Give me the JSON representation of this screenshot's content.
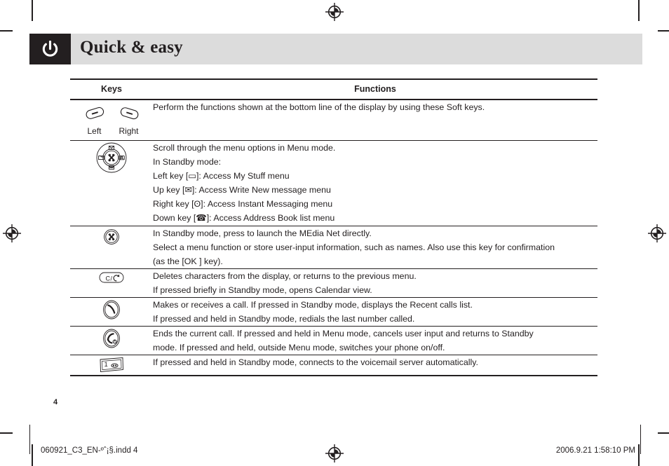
{
  "page": {
    "number": "4",
    "paper_color": "#ffffff",
    "ink_color": "#231f20",
    "header_band_color": "#dcdcdc",
    "header_icon_block_color": "#231f20"
  },
  "header": {
    "title": "Quick & easy",
    "icon": "power-icon"
  },
  "table": {
    "columns": {
      "keys": "Keys",
      "functions": "Functions"
    },
    "rows": [
      {
        "key_icon": "soft-keys-pair-icon",
        "key_labels": [
          "Left",
          "Right"
        ],
        "lines": [
          "Perform the functions shown at the bottom line of the display by using these Soft keys."
        ]
      },
      {
        "key_icon": "navigation-key-icon",
        "key_labels": [],
        "lines": [
          "Scroll through the menu options in Menu mode.",
          "In Standby mode:",
          "Left key [▭]: Access My Stuff menu",
          "Up key [✉]: Access Write New message menu",
          "Right key [ʘ]: Access Instant Messaging menu",
          "Down key [☎]: Access Address Book list menu"
        ]
      },
      {
        "key_icon": "ok-confirm-key-icon",
        "key_labels": [],
        "lines": [
          "In Standby mode, press to launch the MEdia Net directly.",
          "Select a menu function or store user-input information, such as names. Also use this key for confirmation",
          "(as the [OK ] key)."
        ]
      },
      {
        "key_icon": "clear-back-key-icon",
        "key_labels": [],
        "lines": [
          "Deletes characters from the display, or returns to the previous menu.",
          "If pressed briefly in Standby mode, opens Calendar view."
        ]
      },
      {
        "key_icon": "send-call-key-icon",
        "key_labels": [],
        "lines": [
          "Makes or receives a call. If pressed in Standby mode, displays the Recent calls list.",
          "If pressed and held in Standby mode, redials the last number called."
        ]
      },
      {
        "key_icon": "end-power-key-icon",
        "key_labels": [],
        "lines": [
          "Ends the current call. If pressed and held in Menu mode, cancels user input and returns to Standby",
          "mode. If pressed and held, outside Menu mode, switches your phone on/off."
        ]
      },
      {
        "key_icon": "voicemail-one-key-icon",
        "key_labels": [],
        "lines": [
          "If pressed and held in Standby mode, connects to the voicemail server automatically."
        ]
      }
    ]
  },
  "footer": {
    "filename": "060921_C3_EN-ºˆ¡§.indd   4",
    "timestamp": "2006.9.21   1:58:10 PM",
    "registration_mark": "registration-target-icon"
  }
}
